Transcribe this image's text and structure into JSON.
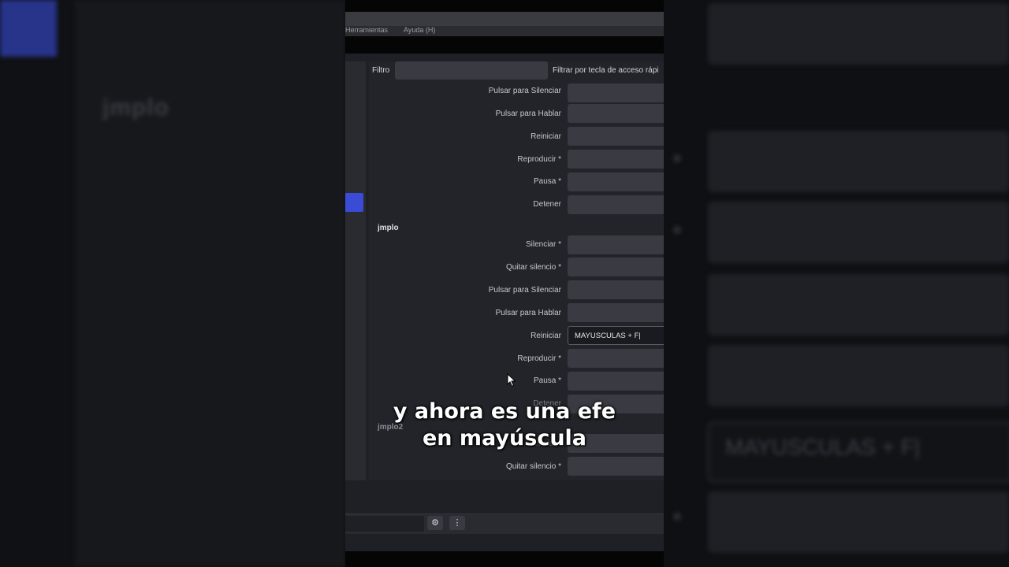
{
  "menu": {
    "item1": "Herramientas",
    "item2": "Ayuda (H)"
  },
  "filter": {
    "label": "Filtro",
    "value": "",
    "key_label": "Filtrar por tecla de acceso rápi"
  },
  "group1": {
    "rows": [
      {
        "label": "Pulsar para Silenciar",
        "value": ""
      },
      {
        "label": "Pulsar para Hablar",
        "value": ""
      },
      {
        "label": "Reiniciar",
        "value": ""
      },
      {
        "label": "Reproducir *",
        "value": ""
      },
      {
        "label": "Pausa *",
        "value": ""
      },
      {
        "label": "Detener",
        "value": ""
      }
    ]
  },
  "group2": {
    "title": "jmplo",
    "rows": [
      {
        "label": "Silenciar *",
        "value": ""
      },
      {
        "label": "Quitar silencio *",
        "value": ""
      },
      {
        "label": "Pulsar para Silenciar",
        "value": ""
      },
      {
        "label": "Pulsar para Hablar",
        "value": ""
      },
      {
        "label": "Reiniciar",
        "value": "MAYUSCULAS + F|"
      },
      {
        "label": "Reproducir *",
        "value": ""
      },
      {
        "label": "Pausa *",
        "value": ""
      },
      {
        "label": "Detener",
        "value": ""
      }
    ]
  },
  "group3": {
    "title": "jmplo2",
    "rows": [
      {
        "label": "Silenciar *",
        "value": ""
      },
      {
        "label": "Quitar silencio *",
        "value": ""
      }
    ]
  },
  "bottom": {
    "gear_icon": "⚙",
    "more_icon": "⋮"
  },
  "background": {
    "left_text": "jmplo",
    "right_typed": "MAYUSCULAS + F|"
  },
  "caption": {
    "line1": "y ahora es una efe",
    "line2": "en mayúscula"
  },
  "colors": {
    "accent": "#3a4bd6",
    "field": "#3a3b42",
    "panel": "#232429"
  }
}
